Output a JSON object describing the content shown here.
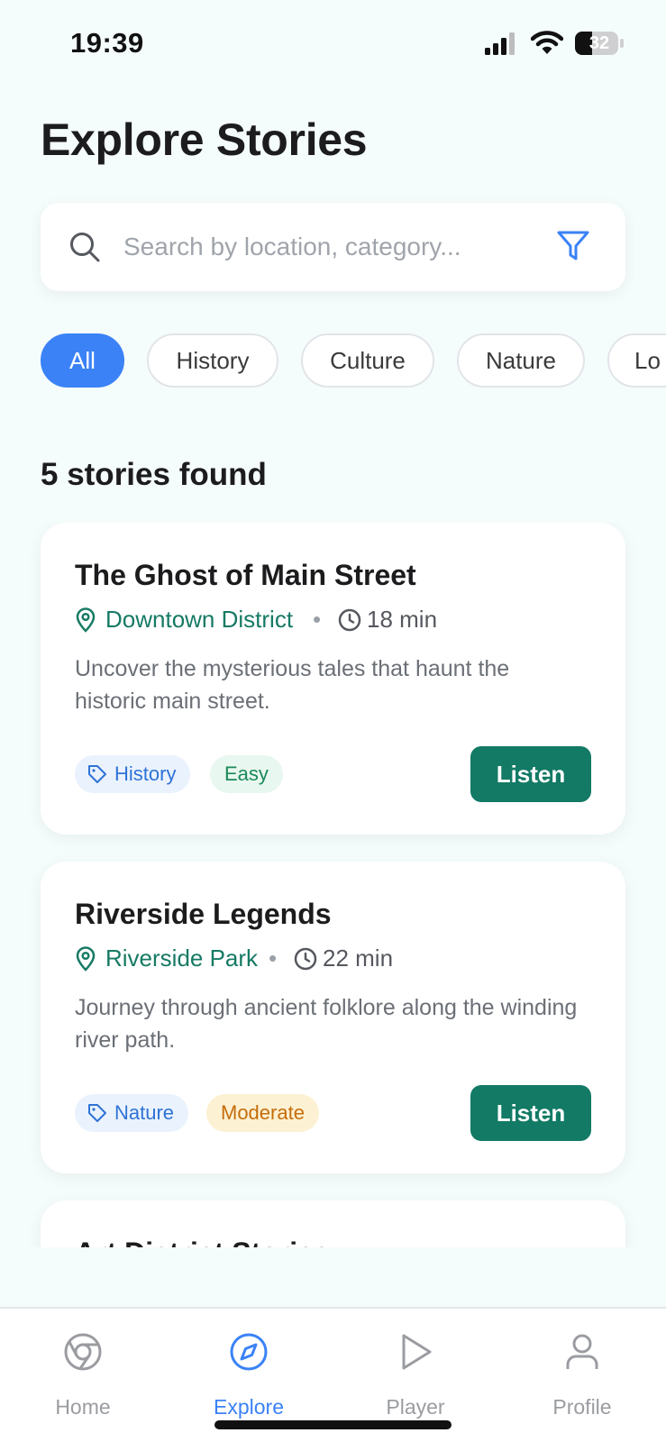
{
  "status_bar": {
    "time": "19:39",
    "battery": "32",
    "icons": [
      "signal-icon",
      "wifi-icon",
      "battery-icon"
    ]
  },
  "page": {
    "title": "Explore Stories"
  },
  "search": {
    "placeholder": "Search by location, category...",
    "value": "",
    "icons": [
      "search-icon",
      "filter-icon"
    ]
  },
  "filters": [
    {
      "label": "All",
      "active": true
    },
    {
      "label": "History",
      "active": false
    },
    {
      "label": "Culture",
      "active": false
    },
    {
      "label": "Nature",
      "active": false
    },
    {
      "label": "Lo",
      "active": false
    }
  ],
  "results": {
    "count_text": "5 stories found"
  },
  "stories": [
    {
      "title": "The Ghost of Main Street",
      "location": "Downtown District",
      "separator": "•",
      "duration": "18 min",
      "description": "Uncover the mysterious tales that haunt the historic main street.",
      "category": "History",
      "difficulty": "Easy",
      "action": "Listen"
    },
    {
      "title": "Riverside Legends",
      "location": "Riverside Park",
      "separator": "•",
      "duration": "22 min",
      "description": "Journey through ancient folklore along the winding river path.",
      "category": "Nature",
      "difficulty": "Moderate",
      "action": "Listen"
    },
    {
      "title": "Art District Stories"
    }
  ],
  "colors": {
    "accent": "#3b82f6",
    "primary_button": "#127a65",
    "location_text": "#167a64",
    "background": "#f5fcfc"
  },
  "bottom_nav": [
    {
      "label": "Home",
      "icon": "home-icon",
      "active": false
    },
    {
      "label": "Explore",
      "icon": "compass-icon",
      "active": true
    },
    {
      "label": "Player",
      "icon": "play-icon",
      "active": false
    },
    {
      "label": "Profile",
      "icon": "user-icon",
      "active": false
    }
  ]
}
